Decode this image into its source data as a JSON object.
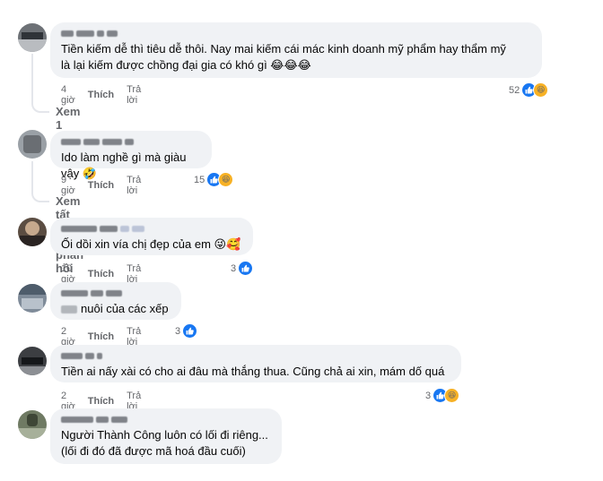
{
  "colors": {
    "like": "#1877f2",
    "haha": "#f7b125",
    "bubble": "#f0f2f5",
    "meta": "#65676b"
  },
  "comments": [
    {
      "text": "Tiền kiếm dễ thì tiêu dễ thôi. Nay mai kiếm cái mác kinh doanh mỹ phẩm hay thẩm mỹ\nlà lại kiếm được chồng đại gia có khó gì 😂😂😂",
      "time": "4 giờ",
      "like_label": "Thích",
      "reply_label": "Trả lời",
      "reaction_count": "52",
      "reactions": [
        "like-icon",
        "haha-icon"
      ],
      "view_replies": "Xem 1 phản hồi"
    },
    {
      "text": "Ido làm nghề gì mà giàu vậy 🤣",
      "time": "9 giờ",
      "like_label": "Thích",
      "reply_label": "Trả lời",
      "reaction_count": "15",
      "reactions": [
        "like-icon",
        "haha-icon"
      ],
      "view_replies": "Xem tất cả 10 phản hồi"
    },
    {
      "text": "Ối dồi xin vía chị đẹp của em 😜🥰",
      "time": "10 giờ",
      "like_label": "Thích",
      "reply_label": "Trả lời",
      "reaction_count": "3",
      "reactions": [
        "like-icon"
      ]
    },
    {
      "text_suffix": "nuôi của các xếp",
      "time": "2 giờ",
      "like_label": "Thích",
      "reply_label": "Trả lời",
      "reaction_count": "3",
      "reactions": [
        "like-icon"
      ]
    },
    {
      "text": "Tiền ai nấy xài có cho ai đâu mà thắng thua. Cũng chả ai xin, mám dố quá",
      "time": "2 giờ",
      "like_label": "Thích",
      "reply_label": "Trả lời",
      "reaction_count": "3",
      "reactions": [
        "like-icon",
        "haha-icon"
      ]
    },
    {
      "text": "Người Thành Công luôn có lối đi riêng...\n(lối đi đó đã được mã hoá đầu cuối)"
    }
  ]
}
